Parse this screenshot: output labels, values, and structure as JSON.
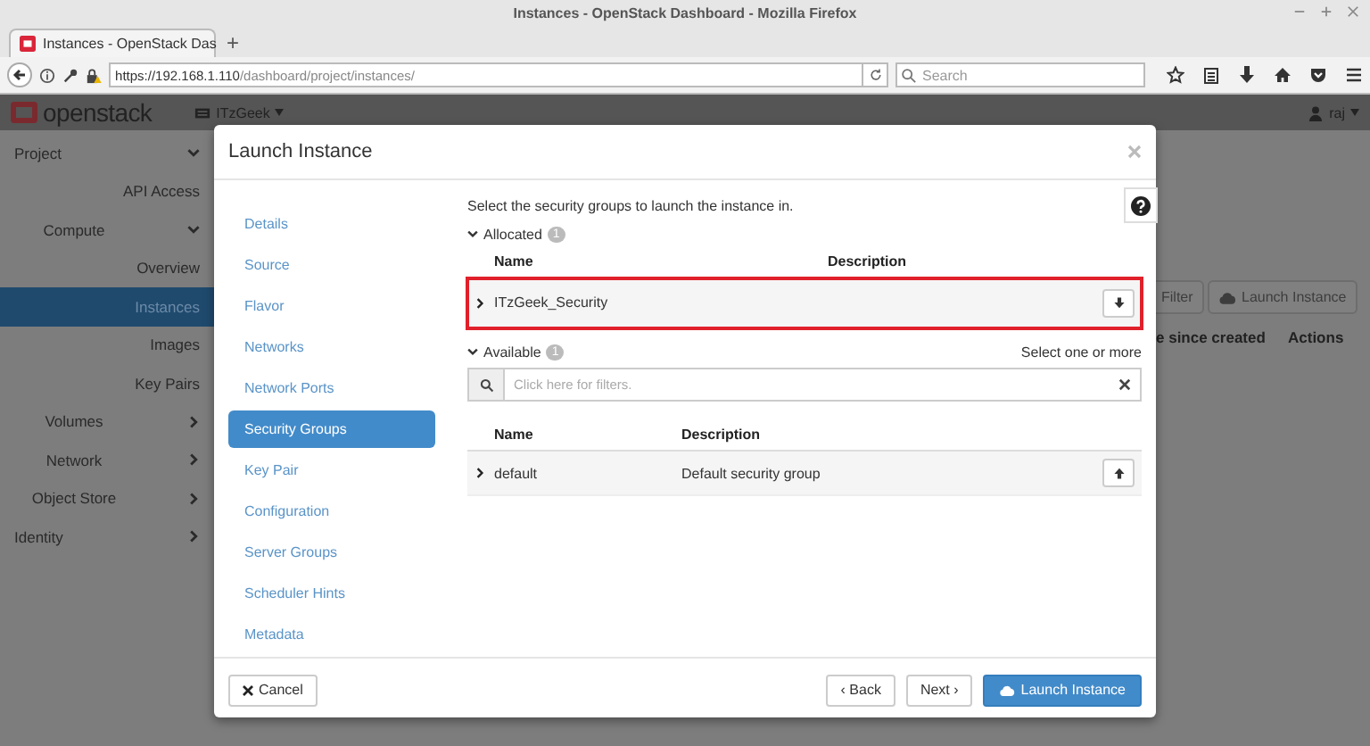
{
  "browser": {
    "title": "Instances - OpenStack Dashboard - Mozilla Firefox",
    "tabs": [
      {
        "label": "Instances - OpenStack Das",
        "selected": true
      }
    ],
    "new_tab": "+",
    "url_host": "https://192.168.1.110",
    "url_path": "/dashboard/project/instances/",
    "search": {
      "placeholder": "Search"
    }
  },
  "header": {
    "logo": "openstack",
    "project": "ITzGeek",
    "user": "raj"
  },
  "sidebar": {
    "items": [
      {
        "label": "Project",
        "expanded": true,
        "children": [
          {
            "label": "API Access",
            "selected": false
          },
          {
            "label": "Compute",
            "expanded": true,
            "children": [
              {
                "label": "Overview",
                "selected": false
              },
              {
                "label": "Instances",
                "selected": true
              },
              {
                "label": "Images",
                "selected": false
              },
              {
                "label": "Key Pairs",
                "selected": false
              }
            ]
          },
          {
            "label": "Volumes",
            "expanded": false
          },
          {
            "label": "Network",
            "expanded": false
          },
          {
            "label": "Object Store",
            "expanded": false
          }
        ]
      },
      {
        "label": "Identity",
        "expanded": false
      }
    ]
  },
  "page": {
    "buttons": [
      "Filter",
      "Launch Instance"
    ],
    "columns": [
      "e since created",
      "Actions"
    ]
  },
  "modal": {
    "title": "Launch Instance",
    "steps": [
      {
        "label": "Details",
        "selected": false
      },
      {
        "label": "Source",
        "selected": false
      },
      {
        "label": "Flavor",
        "selected": false
      },
      {
        "label": "Networks",
        "selected": false
      },
      {
        "label": "Network Ports",
        "selected": false
      },
      {
        "label": "Security Groups",
        "selected": true
      },
      {
        "label": "Key Pair",
        "selected": false
      },
      {
        "label": "Configuration",
        "selected": false
      },
      {
        "label": "Server Groups",
        "selected": false
      },
      {
        "label": "Scheduler Hints",
        "selected": false
      },
      {
        "label": "Metadata",
        "selected": false
      }
    ],
    "intro": "Select the security groups to launch the instance in.",
    "allocated": {
      "label": "Allocated",
      "count": "1",
      "expanded": true,
      "columns": [
        "Name",
        "Description"
      ],
      "rows": [
        {
          "name": "ITzGeek_Security",
          "highlighted": true
        }
      ]
    },
    "available": {
      "label": "Available",
      "count": "1",
      "expanded": true,
      "hint": "Select one or more",
      "filter": {
        "placeholder": "Click here for filters."
      },
      "columns": [
        "Name",
        "Description"
      ],
      "rows": [
        {
          "name": "default",
          "description": "Default security group",
          "highlighted": false
        }
      ]
    },
    "footer": {
      "cancel": "Cancel",
      "back": "‹ Back",
      "next": "Next ›",
      "launch": "Launch Instance"
    }
  }
}
